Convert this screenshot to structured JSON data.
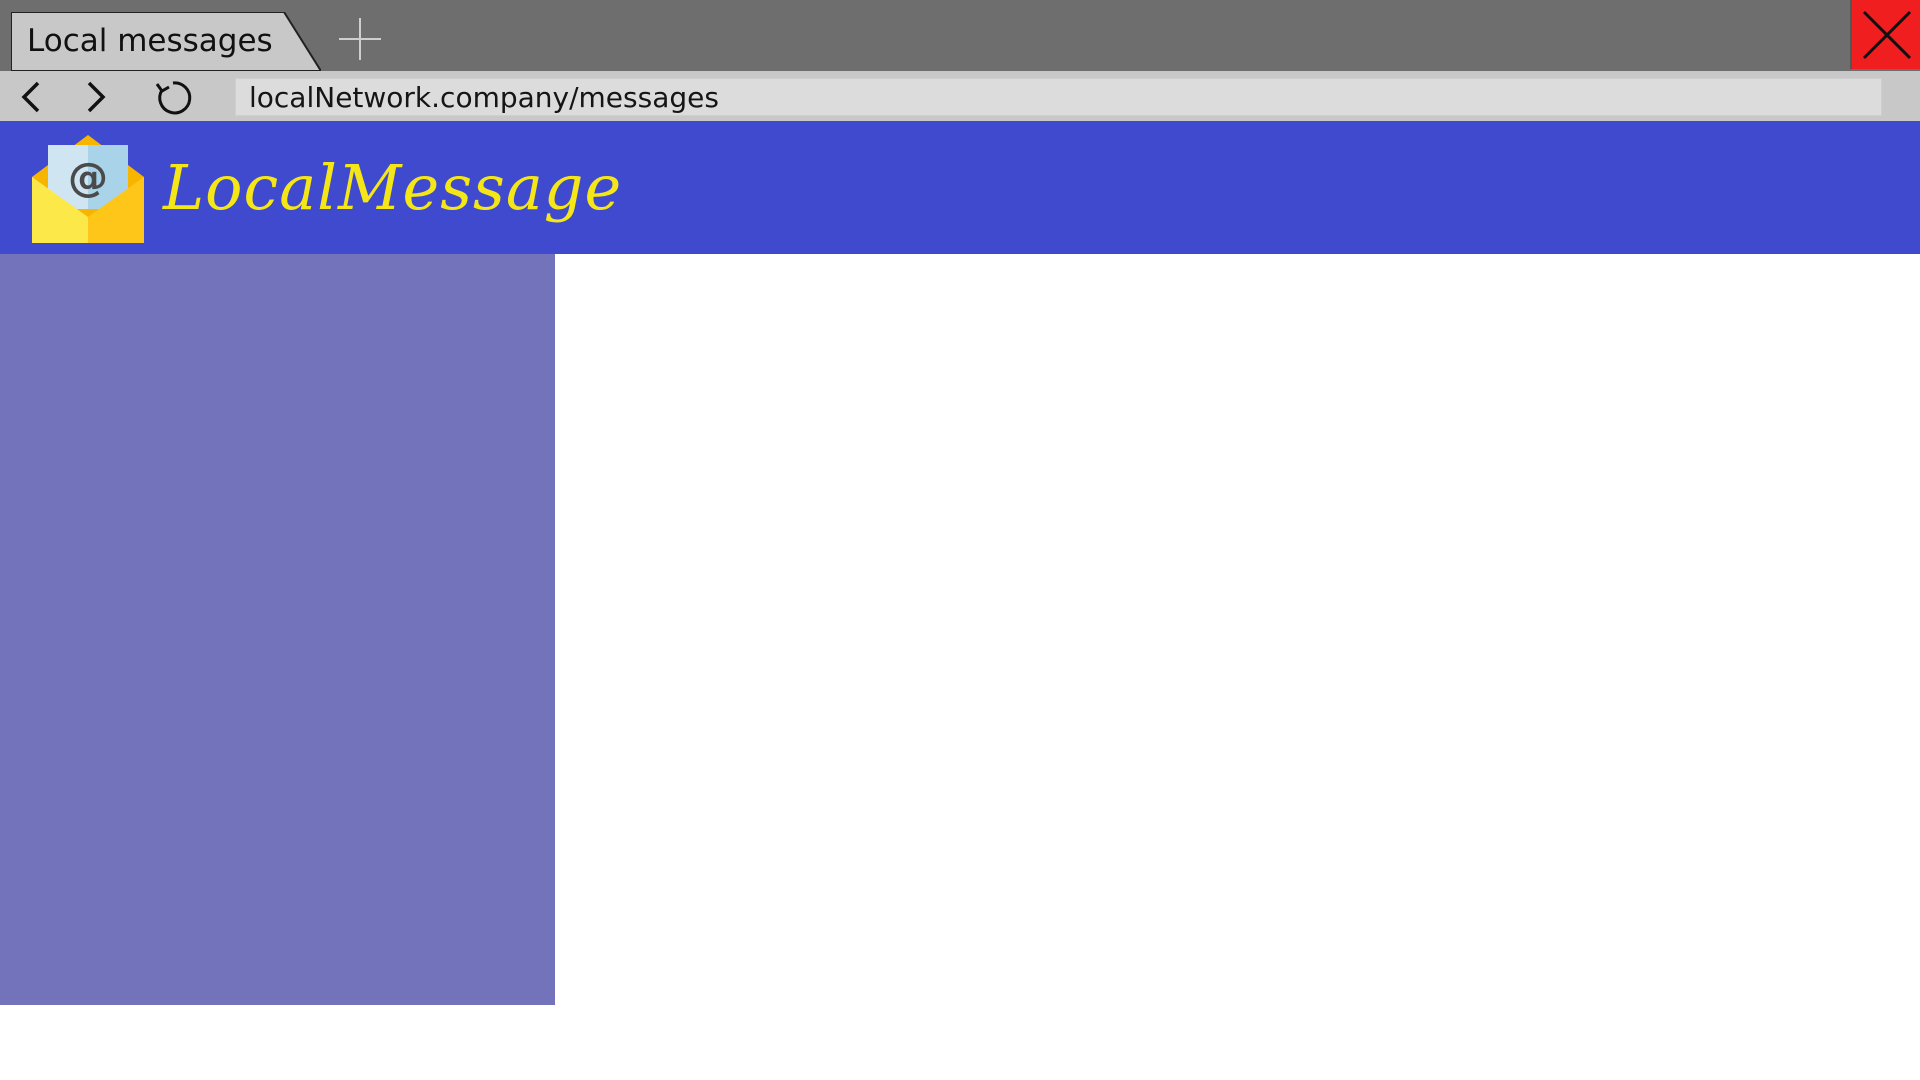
{
  "browser": {
    "tab": {
      "title": "Local messages"
    },
    "new_tab_icon": "plus-icon",
    "close_icon": "close-icon",
    "nav": {
      "back_icon": "chevron-left-icon",
      "forward_icon": "chevron-right-icon",
      "reload_icon": "reload-icon"
    },
    "address": {
      "url": "localNetwork.company/messages"
    }
  },
  "app": {
    "brand_name": "LocalMessage",
    "logo_icon": "email-envelope-icon"
  },
  "colors": {
    "tabbar_bg": "#6e6e6e",
    "navbar_bg": "#c8c8c8",
    "close_button": "#f01e1e",
    "header_bg": "#3f4acf",
    "brand_text": "#f5e617",
    "sidebar_bg": "#7373bb",
    "content_bg": "#ffffff"
  }
}
